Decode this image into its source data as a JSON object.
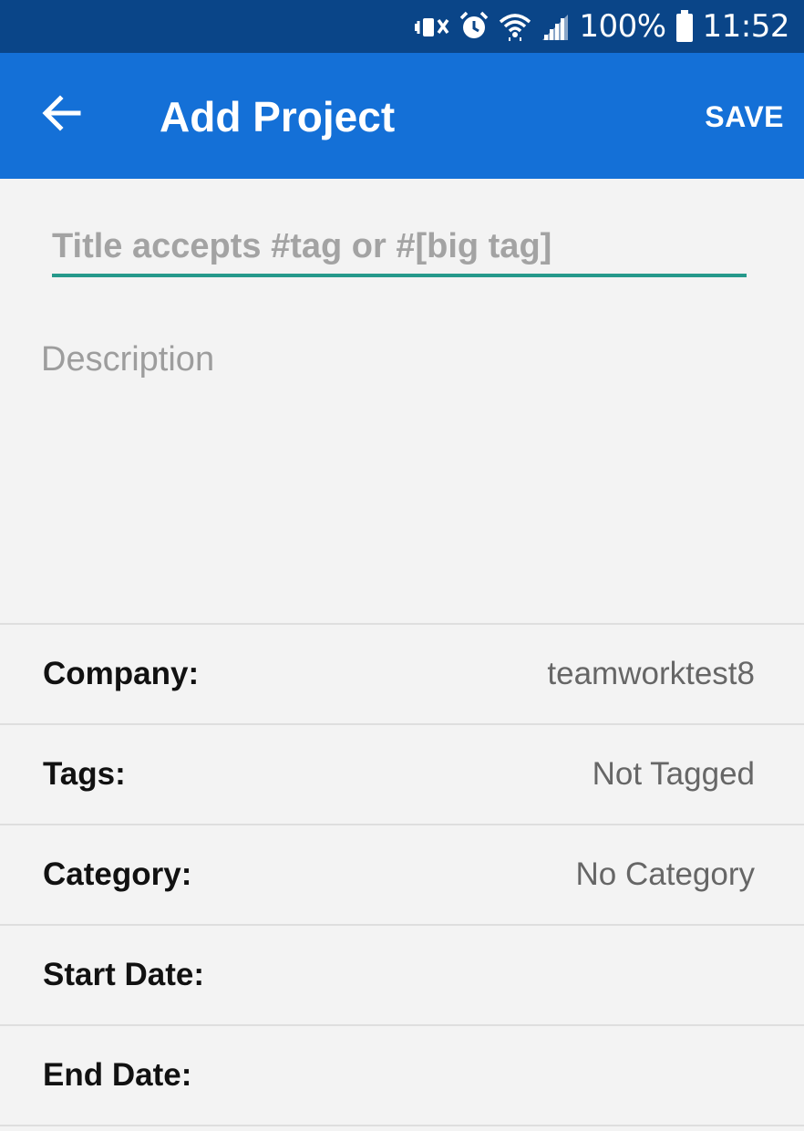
{
  "status_bar": {
    "battery_text": "100%",
    "time": "11:52",
    "icons": [
      "vibrate-mute-icon",
      "alarm-icon",
      "wifi-icon",
      "cell-signal-icon",
      "battery-icon"
    ]
  },
  "app_bar": {
    "title": "Add Project",
    "save_label": "SAVE",
    "back_icon": "arrow-back-icon",
    "background": "#1470d7"
  },
  "form": {
    "title_placeholder": "Title accepts #tag or #[big tag]",
    "title_value": "",
    "description_placeholder": "Description",
    "description_value": "",
    "accent": "#26998b"
  },
  "fields": [
    {
      "label": "Company:",
      "value": "teamworktest8"
    },
    {
      "label": "Tags:",
      "value": "Not Tagged"
    },
    {
      "label": "Category:",
      "value": "No Category"
    },
    {
      "label": "Start Date:",
      "value": ""
    },
    {
      "label": "End Date:",
      "value": ""
    }
  ]
}
